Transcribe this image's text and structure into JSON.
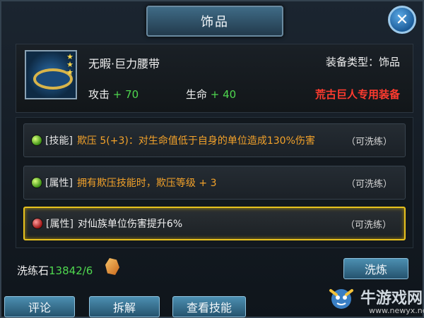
{
  "header": {
    "title": "饰品"
  },
  "item": {
    "name": "无暇·巨力腰带",
    "type_label": "装备类型：饰品",
    "attack_label": "攻击",
    "attack_value": "+ 70",
    "hp_label": "生命",
    "hp_value": "+ 40",
    "exclusive": "荒古巨人专用装备",
    "stars": 3
  },
  "properties": [
    {
      "tag": "[技能]",
      "desc": "欺压 5(+3)：对生命值低于自身的单位造成130%伤害",
      "wash": "（可洗练）",
      "gem": "green",
      "color": "orange"
    },
    {
      "tag": "[属性]",
      "desc": "拥有欺压技能时，欺压等级 + 3",
      "wash": "（可洗练）",
      "gem": "green",
      "color": "orange"
    },
    {
      "tag": "[属性]",
      "desc": "对仙族单位伤害提升6%",
      "wash": "（可洗练）",
      "gem": "red",
      "color": "white"
    }
  ],
  "wash_stone": {
    "label": "洗练石",
    "count": "13842/6"
  },
  "buttons": {
    "wash": "洗炼",
    "comment": "评论",
    "decompose": "拆解",
    "view_skills": "查看技能"
  },
  "watermark": {
    "text": "牛游戏网",
    "url": "www.newyx.net"
  },
  "colors": {
    "accent_green": "#4fd84f",
    "exclusive_red": "#ff3b2f",
    "highlight_gold": "#e8c21e"
  }
}
